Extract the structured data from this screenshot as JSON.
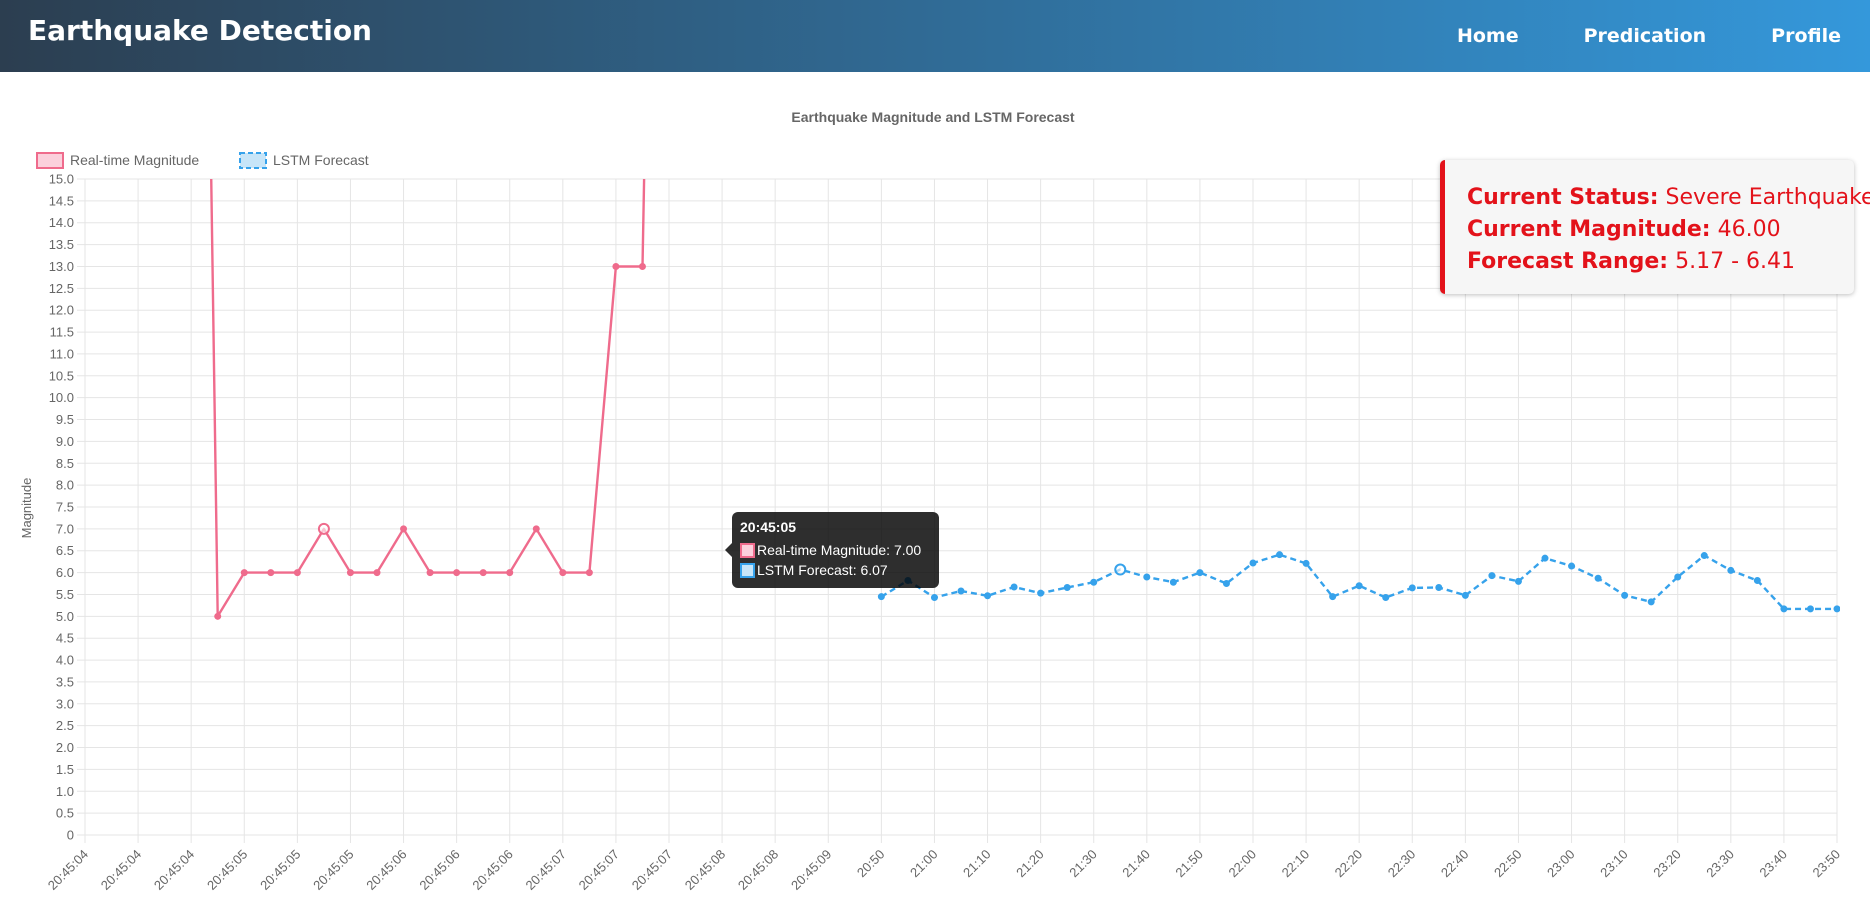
{
  "navbar": {
    "brand": "Earthquake Detection",
    "links": [
      "Home",
      "Predication",
      "Profile"
    ]
  },
  "status_card": {
    "status_label": "Current Status:",
    "status_value": "Severe Earthquake",
    "magnitude_label": "Current Magnitude:",
    "magnitude_value": "46.00",
    "range_label": "Forecast Range:",
    "range_value": "5.17 - 6.41",
    "accent_color": "#e3121a"
  },
  "tooltip": {
    "title": "20:45:05",
    "rows": [
      "Real-time Magnitude: 7.00",
      "LSTM Forecast: 6.07"
    ]
  },
  "chart_data": {
    "type": "line",
    "title": "Earthquake Magnitude and LSTM Forecast",
    "ylabel": "Magnitude",
    "xlabel": "",
    "ylim": [
      0,
      15
    ],
    "y_step": 0.5,
    "grid": true,
    "legend_position": "top-left",
    "categories": [
      "20:45:04",
      "20:45:04",
      "20:45:04",
      "20:45:05",
      "20:45:05",
      "20:45:05",
      "20:45:06",
      "20:45:06",
      "20:45:06",
      "20:45:07",
      "20:45:07",
      "20:45:07",
      "20:45:08",
      "20:45:08",
      "20:45:09",
      "20:50",
      "21:00",
      "21:10",
      "21:20",
      "21:30",
      "21:40",
      "21:50",
      "22:00",
      "22:10",
      "22:20",
      "22:30",
      "22:40",
      "22:50",
      "23:00",
      "23:10",
      "23:20",
      "23:30",
      "23:40",
      "23:50"
    ],
    "series": [
      {
        "name": "Real-time Magnitude",
        "color": "#ef6b8c",
        "dashed": false,
        "x": [
          2.0,
          2.5,
          3.0,
          3.5,
          4.0,
          4.5,
          5.0,
          5.5,
          6.0,
          6.5,
          7.0,
          7.5,
          8.0,
          8.5,
          9.0,
          9.5,
          10.0,
          10.5,
          11.0,
          11.5,
          12.0
        ],
        "y": [
          46.0,
          5.0,
          6.0,
          6.0,
          6.0,
          7.0,
          6.0,
          6.0,
          7.0,
          6.0,
          6.0,
          6.0,
          6.0,
          7.0,
          6.0,
          6.0,
          13.0,
          13.0,
          46.0,
          null,
          null
        ]
      },
      {
        "name": "LSTM Forecast",
        "color": "#36a2eb",
        "dashed": true,
        "x": [
          15.0,
          15.5,
          16.0,
          16.5,
          17.0,
          17.5,
          18.0,
          18.5,
          19.0,
          19.5,
          20.0,
          20.5,
          21.0,
          21.5,
          22.0,
          22.5,
          23.0,
          23.5,
          24.0,
          24.5,
          25.0,
          25.5,
          26.0,
          26.5,
          27.0,
          27.5,
          28.0,
          28.5,
          29.0,
          29.5,
          30.0,
          30.5,
          31.0,
          31.5,
          32.0,
          32.5,
          33.0
        ],
        "y": [
          5.45,
          5.82,
          5.43,
          5.58,
          5.47,
          5.67,
          5.53,
          5.66,
          5.78,
          6.07,
          5.9,
          5.78,
          6.0,
          5.75,
          6.22,
          6.41,
          6.21,
          5.45,
          5.7,
          5.43,
          5.65,
          5.66,
          5.48,
          5.93,
          5.8,
          6.33,
          6.15,
          5.87,
          5.48,
          5.33,
          5.9,
          6.39,
          6.05,
          5.82,
          5.17,
          5.17,
          5.17
        ]
      }
    ],
    "highlighted": {
      "series0_x": 4.5,
      "series1_x": 19.5
    }
  }
}
